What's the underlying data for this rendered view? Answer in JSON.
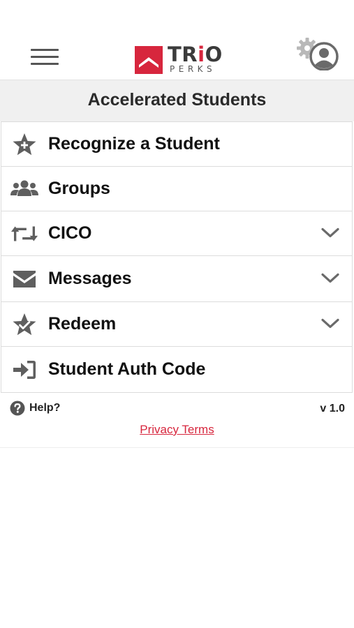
{
  "header": {
    "logo": {
      "word_main": "TR",
      "word_accent": "i",
      "word_end": "O",
      "sub": "PERKS",
      "brand_color": "#d7263d"
    },
    "menu_icon": "hamburger-icon",
    "settings_icon": "gear-icon",
    "profile_icon": "user-circle-icon"
  },
  "section": {
    "title": "Accelerated Students"
  },
  "menu": {
    "items": [
      {
        "label": "Recognize a Student",
        "icon": "star-plus-icon",
        "expandable": false
      },
      {
        "label": "Groups",
        "icon": "users-icon",
        "expandable": false
      },
      {
        "label": "CICO",
        "icon": "retweet-icon",
        "expandable": true
      },
      {
        "label": "Messages",
        "icon": "envelope-icon",
        "expandable": true
      },
      {
        "label": "Redeem",
        "icon": "star-check-icon",
        "expandable": true
      },
      {
        "label": "Student Auth Code",
        "icon": "sign-in-icon",
        "expandable": false
      }
    ]
  },
  "footer": {
    "help_label": "Help?",
    "help_icon": "question-circle-icon",
    "version": "v 1.0",
    "privacy_label": "Privacy Terms"
  },
  "colors": {
    "accent": "#d7263d",
    "icon_gray": "#5f5f5f",
    "section_bg": "#f0f0f0"
  }
}
